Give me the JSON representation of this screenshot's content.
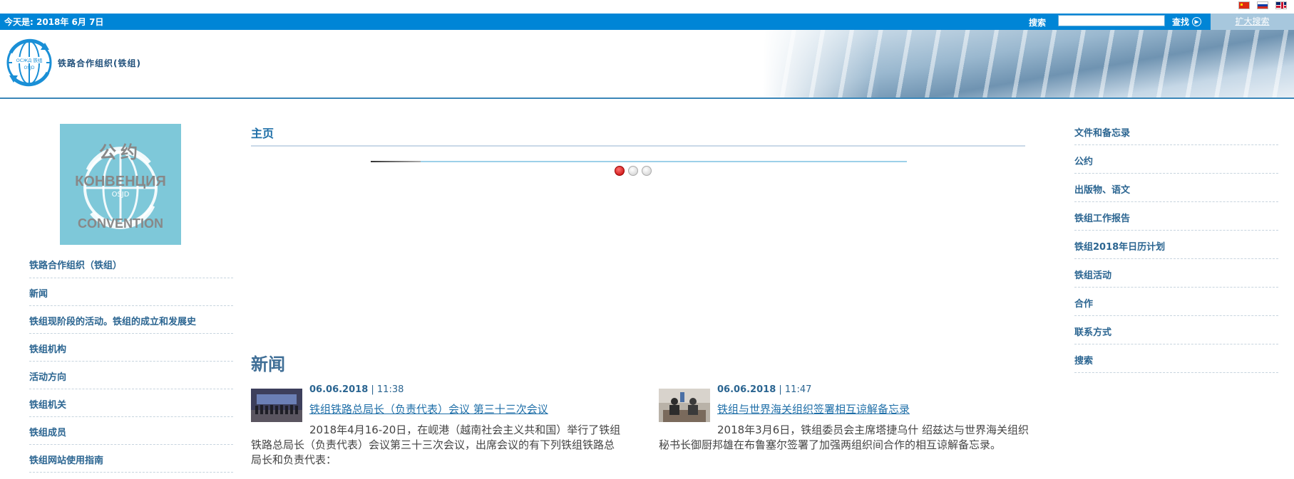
{
  "flags": [
    {
      "name": "chinese-flag-icon"
    },
    {
      "name": "russian-flag-icon"
    },
    {
      "name": "english-flag-icon"
    }
  ],
  "topbar": {
    "date": "今天是: 2018年 6月 7日",
    "search_label": "搜索",
    "search_value": "",
    "find_button": "查找",
    "advanced_search": "扩大搜索"
  },
  "header": {
    "org_name": "铁路合作组织(铁组)",
    "logo_text_top": "ОСЖД  铁组",
    "logo_text_bottom": "OSJD"
  },
  "left_nav": {
    "convention_image": {
      "line1": "公约",
      "line2": "КОНВЕНЦИЯ",
      "line3": "CONVENTION",
      "logo_text": "OSJD"
    },
    "items": [
      {
        "label": "铁路合作组织（铁组）"
      },
      {
        "label": "新闻"
      },
      {
        "label": "铁组现阶段的活动。铁组的成立和发展史"
      },
      {
        "label": "铁组机构"
      },
      {
        "label": "活动方向"
      },
      {
        "label": "铁组机关"
      },
      {
        "label": "铁组成员"
      },
      {
        "label": "铁组网站使用指南"
      }
    ]
  },
  "main": {
    "page_title": "主页",
    "slider_dots": 3,
    "active_dot": 0,
    "news_heading": "新闻",
    "news": [
      {
        "date": "06.06.2018",
        "separator": " | ",
        "time": "11:38",
        "title": "铁组铁路总局长（负责代表）会议 第三十三次会议",
        "text": "2018年4月16-20日，在岘港（越南社会主义共和国）举行了铁组铁路总局长（负责代表）会议第三十三次会议，出席会议的有下列铁组铁路总局长和负责代表："
      },
      {
        "date": "06.06.2018",
        "separator": " | ",
        "time": "11:47",
        "title": "铁组与世界海关组织签署相互谅解备忘录",
        "text": "2018年3月6日，铁组委员会主席塔捷乌什 绍兹达与世界海关组织秘书长御厨邦雄在布鲁塞尔签署了加强两组织间合作的相互谅解备忘录。"
      }
    ]
  },
  "right_nav": {
    "items": [
      {
        "label": "文件和备忘录"
      },
      {
        "label": "公约"
      },
      {
        "label": "出版物、语文"
      },
      {
        "label": "铁组工作报告"
      },
      {
        "label": "铁组2018年日历计划"
      },
      {
        "label": "铁组活动"
      },
      {
        "label": "合作"
      },
      {
        "label": "联系方式"
      },
      {
        "label": "搜索"
      }
    ]
  },
  "colors": {
    "topbar": "#0085d6",
    "advanced_search_bg": "#a7c7dd",
    "link": "#1f6fa8",
    "nav_text": "#2b6591",
    "convention_bg": "#7ec8d9",
    "active_dot": "#c00000"
  }
}
